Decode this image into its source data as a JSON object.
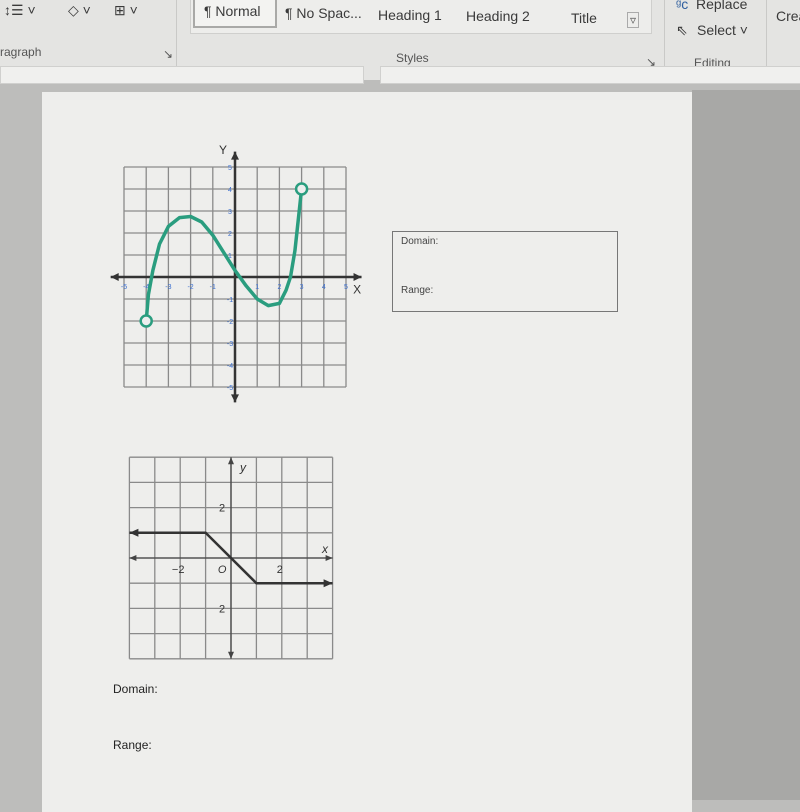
{
  "ribbon": {
    "paragraph_group": "ragraph",
    "styles": [
      "¶ Normal",
      "¶ No Spac...",
      "Heading 1",
      "Heading 2",
      "Title"
    ],
    "styles_group": "Styles",
    "editing": {
      "replace": "Replace",
      "select": "Select",
      "group": "Editing"
    },
    "cut_off": "Crea"
  },
  "document": {
    "box": {
      "domain_label": "Domain:",
      "range_label": "Range:"
    },
    "q2": {
      "domain_label": "Domain:",
      "range_label": "Range:"
    }
  },
  "chart_data": [
    {
      "type": "line",
      "xlabel": "X",
      "ylabel": "Y",
      "xlim": [
        -5,
        5
      ],
      "ylim": [
        -5,
        5
      ],
      "grid": true,
      "xticks": [
        -5,
        -4,
        -3,
        -2,
        -1,
        1,
        2,
        3,
        4,
        5
      ],
      "yticks": [
        5,
        4,
        3,
        2,
        1,
        -1,
        -2,
        -3,
        -4,
        -5
      ],
      "color": "#2a9d7f",
      "endpoints": [
        {
          "x": -4,
          "y": -2,
          "open": true
        },
        {
          "x": 3,
          "y": 4,
          "open": true
        }
      ],
      "points": [
        [
          -4,
          -2
        ],
        [
          -3.9,
          -0.8
        ],
        [
          -3.7,
          0.3
        ],
        [
          -3.4,
          1.5
        ],
        [
          -3,
          2.3
        ],
        [
          -2.5,
          2.7
        ],
        [
          -2,
          2.75
        ],
        [
          -1.5,
          2.5
        ],
        [
          -1,
          1.9
        ],
        [
          -0.5,
          1.1
        ],
        [
          0,
          0.3
        ],
        [
          0.5,
          -0.4
        ],
        [
          1,
          -1
        ],
        [
          1.5,
          -1.3
        ],
        [
          2,
          -1.2
        ],
        [
          2.3,
          -0.6
        ],
        [
          2.5,
          0
        ],
        [
          2.7,
          1.2
        ],
        [
          2.85,
          2.6
        ],
        [
          3,
          4
        ]
      ]
    },
    {
      "type": "line",
      "xlabel": "x",
      "ylabel": "y",
      "xlim": [
        -4,
        4
      ],
      "ylim": [
        -4,
        4
      ],
      "grid": true,
      "xtick_labels": [
        {
          "v": -2,
          "t": "−2"
        },
        {
          "v": 2,
          "t": "2"
        }
      ],
      "ytick_labels": [
        {
          "v": 2,
          "t": "2"
        },
        {
          "v": -2,
          "t": "2"
        }
      ],
      "origin_label": "O",
      "color": "#333333",
      "points": [
        [
          -4,
          1
        ],
        [
          -1,
          1
        ],
        [
          1,
          -1
        ],
        [
          4,
          -1
        ]
      ],
      "arrows": [
        "left",
        "right"
      ]
    }
  ]
}
